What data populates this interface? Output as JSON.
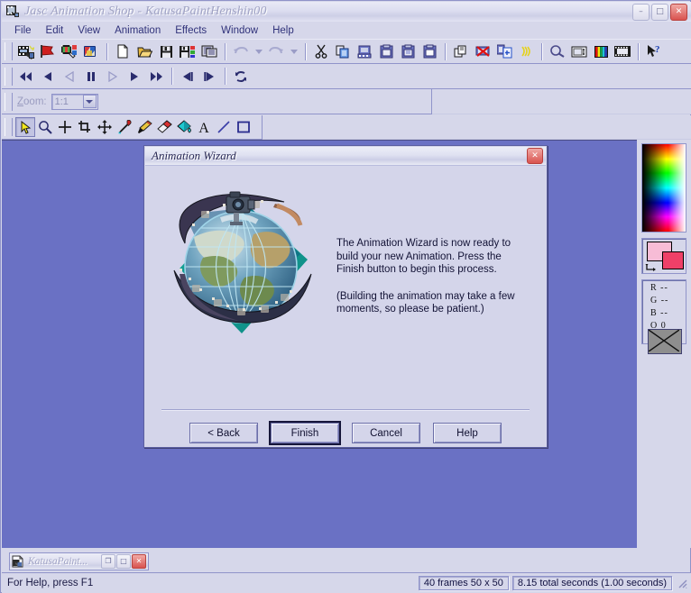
{
  "window": {
    "title": "Jasc Animation Shop - KatusaPaintHenshin00",
    "app_icon": "animation-shop-icon",
    "buttons": {
      "minimize": "–",
      "maximize": "□",
      "close": "✕"
    }
  },
  "menubar": {
    "items": [
      "File",
      "Edit",
      "View",
      "Animation",
      "Effects",
      "Window",
      "Help"
    ]
  },
  "toolbars": {
    "standard": [
      {
        "name": "animation-wizard-icon",
        "title": "Animation Wizard"
      },
      {
        "name": "banner-wizard-icon",
        "title": "Banner Wizard"
      },
      {
        "name": "transition-wizard-icon",
        "title": "Transition Wizard"
      },
      {
        "name": "image-wizard-icon",
        "title": "Image Wizard"
      },
      {
        "name": "new-icon",
        "title": "New"
      },
      {
        "name": "open-folder-icon",
        "title": "Open"
      },
      {
        "name": "save-icon",
        "title": "Save"
      },
      {
        "name": "save-frames-icon",
        "title": "Save Frames As"
      },
      {
        "name": "optimization-wizard-icon",
        "title": "Optimization Wizard"
      },
      {
        "name": "undo-icon",
        "title": "Undo"
      },
      {
        "name": "undo-dropdown-icon",
        "title": "Undo history"
      },
      {
        "name": "redo-icon",
        "title": "Redo"
      },
      {
        "name": "redo-dropdown-icon",
        "title": "Redo history"
      },
      {
        "name": "cut-icon",
        "title": "Cut"
      },
      {
        "name": "copy-icon",
        "title": "Copy"
      },
      {
        "name": "copy-frames-icon",
        "title": "Copy Frames"
      },
      {
        "name": "paste-new-animation-icon",
        "title": "Paste As New Animation"
      },
      {
        "name": "paste-new-frames-icon",
        "title": "Paste As New Frames"
      },
      {
        "name": "paste-into-frame-icon",
        "title": "Paste Into Selected Frame"
      },
      {
        "name": "duplicate-selected-icon",
        "title": "Duplicate Selected"
      },
      {
        "name": "delete-frames-icon",
        "title": "Delete Frames"
      },
      {
        "name": "insert-frames-icon",
        "title": "Insert Frames"
      },
      {
        "name": "propagate-paste-icon",
        "title": "Propagate Paste"
      },
      {
        "name": "animation-properties-icon",
        "title": "Animation Properties"
      },
      {
        "name": "frame-properties-icon",
        "title": "Frame Properties"
      },
      {
        "name": "color-palette-icon",
        "title": "Colors"
      },
      {
        "name": "view-animation-icon",
        "title": "View Animation"
      },
      {
        "name": "help-pointer-icon",
        "title": "Context Help"
      }
    ],
    "playback": [
      {
        "name": "first-frame-icon",
        "title": "First Frame"
      },
      {
        "name": "rewind-icon",
        "title": "Rewind"
      },
      {
        "name": "step-back-icon",
        "title": "Step Back"
      },
      {
        "name": "pause-icon",
        "title": "Pause"
      },
      {
        "name": "play-back-icon",
        "title": "Play Backwards"
      },
      {
        "name": "play-icon",
        "title": "Play"
      },
      {
        "name": "fast-forward-icon",
        "title": "Fast Forward"
      },
      {
        "name": "previous-frame-icon",
        "title": "Previous Frame"
      },
      {
        "name": "next-frame-icon",
        "title": "Next Frame"
      },
      {
        "name": "loop-icon",
        "title": "Loop"
      }
    ],
    "zoom": {
      "label": "Zoom:",
      "label_mnemonic": "Z",
      "label_rest": "oom:",
      "value": "1:1",
      "dropdown_icon": "chevron-down-icon"
    },
    "tools": [
      {
        "name": "arrow-tool-icon",
        "title": "Arrow",
        "selected": true
      },
      {
        "name": "zoom-tool-icon",
        "title": "Zoom",
        "selected": false
      },
      {
        "name": "registration-tool-icon",
        "title": "Registration Point",
        "selected": false
      },
      {
        "name": "crop-tool-icon",
        "title": "Crop",
        "selected": false
      },
      {
        "name": "mover-tool-icon",
        "title": "Mover",
        "selected": false
      },
      {
        "name": "dropper-tool-icon",
        "title": "Dropper",
        "selected": false
      },
      {
        "name": "paint-brush-tool-icon",
        "title": "Paint Brush",
        "selected": false
      },
      {
        "name": "eraser-tool-icon",
        "title": "Eraser",
        "selected": false
      },
      {
        "name": "flood-fill-tool-icon",
        "title": "Flood Fill",
        "selected": false
      },
      {
        "name": "text-tool-icon",
        "title": "Text",
        "selected": false
      },
      {
        "name": "line-tool-icon",
        "title": "Draw",
        "selected": false
      },
      {
        "name": "shape-tool-icon",
        "title": "Preset Shapes",
        "selected": false
      }
    ]
  },
  "color_panel": {
    "gradient_name": "color-gradient-picker",
    "foreground_color": "#f7bcd6",
    "background_color": "#ef4068",
    "swap_icon": "swap-colors-icon",
    "readouts": [
      "R --",
      "G --",
      "B --",
      "O 0"
    ],
    "texture_swatch_name": "texture-swatch"
  },
  "dialog": {
    "title": "Animation Wizard",
    "close_icon": "✕",
    "image_name": "globe-filmstrip-image",
    "paragraph1": "The Animation Wizard is now ready to build your new Animation.  Press the Finish button to begin this process.",
    "paragraph2": "(Building the animation may take a few moments, so please be patient.)",
    "buttons": [
      {
        "label": "< Back",
        "name": "back-button",
        "default": false
      },
      {
        "label": "Finish",
        "name": "finish-button",
        "default": true
      },
      {
        "label": "Cancel",
        "name": "cancel-button",
        "default": false
      },
      {
        "label": "Help",
        "name": "help-button",
        "default": false
      }
    ]
  },
  "minimized_child": {
    "title": "KatusaPaint...",
    "icon": "document-icon",
    "restore": "❐",
    "maximize": "□",
    "close": "✕"
  },
  "statusbar": {
    "help_text": "For Help, press F1",
    "frames": "40 frames   50 x 50",
    "seconds": "8.15 total seconds   (1.00 seconds)",
    "grip_name": "resize-grip"
  },
  "colors": {
    "workspace": "#6a71c4",
    "chrome": "#d6d7ea",
    "dialog": "#d4d5ea",
    "accent": "#30327a"
  }
}
